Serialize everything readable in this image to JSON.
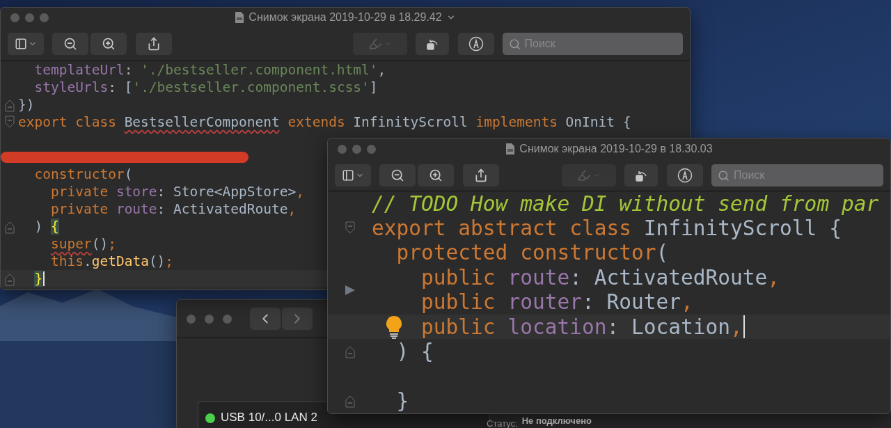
{
  "desktop": {
    "network_window": {
      "list_item": {
        "label": "USB 10/...0 LAN 2",
        "color": "#4cd04b"
      },
      "status_label": "Статус:",
      "status_value": "Не подключено"
    },
    "windows": [
      {
        "title": "Снимок экрана 2019-10-29 в 18.29.42",
        "title_menu": true,
        "toolbar": {
          "highlight_disabled": true,
          "search_placeholder": "Поиск"
        },
        "lines": [
          {
            "tokens": [
              {
                "text": "  templateUrl",
                "kind": "property"
              },
              {
                "text": ": ",
                "kind": "plain"
              },
              {
                "text": "'./bestseller.component.html'",
                "kind": "string"
              },
              {
                "text": ",",
                "kind": "plain"
              }
            ]
          },
          {
            "tokens": [
              {
                "text": "  styleUrls",
                "kind": "property"
              },
              {
                "text": ": [",
                "kind": "plain"
              },
              {
                "text": "'./bestseller.component.scss'",
                "kind": "string"
              },
              {
                "text": "]",
                "kind": "plain"
              }
            ]
          },
          {
            "fold_end": true,
            "tokens": [
              {
                "text": "})",
                "kind": "plain"
              }
            ]
          },
          {
            "fold_start": true,
            "tokens": [
              {
                "text": "export class ",
                "kind": "keyword"
              },
              {
                "text": "BestsellerComponent",
                "kind": "plain",
                "squiggle": true
              },
              {
                "text": " extends ",
                "kind": "keyword"
              },
              {
                "text": "InfinityScroll ",
                "kind": "plain"
              },
              {
                "text": "implements ",
                "kind": "keyword"
              },
              {
                "text": "OnInit {",
                "kind": "plain"
              }
            ]
          },
          {
            "blank": true
          },
          {
            "redacted": true
          },
          {
            "tokens": [
              {
                "text": "  constructor",
                "kind": "keyword"
              },
              {
                "text": "(",
                "kind": "plain"
              }
            ]
          },
          {
            "tokens": [
              {
                "text": "    private ",
                "kind": "keyword"
              },
              {
                "text": "store",
                "kind": "property"
              },
              {
                "text": ": Store<AppStore>",
                "kind": "plain"
              },
              {
                "text": ",",
                "kind": "keyword"
              }
            ]
          },
          {
            "tokens": [
              {
                "text": "    private ",
                "kind": "keyword"
              },
              {
                "text": "route",
                "kind": "property"
              },
              {
                "text": ": ActivatedRoute",
                "kind": "plain"
              },
              {
                "text": ",",
                "kind": "keyword"
              }
            ]
          },
          {
            "fold_end": true,
            "tokens": [
              {
                "text": "  ) ",
                "kind": "plain"
              },
              {
                "text": "{",
                "kind": "brace_match"
              }
            ]
          },
          {
            "tokens": [
              {
                "text": "    super",
                "kind": "keyword",
                "squiggle": true
              },
              {
                "text": "()",
                "kind": "plain"
              },
              {
                "text": ";",
                "kind": "keyword"
              }
            ]
          },
          {
            "tokens": [
              {
                "text": "    this",
                "kind": "keyword"
              },
              {
                "text": ".",
                "kind": "plain"
              },
              {
                "text": "getData",
                "kind": "function"
              },
              {
                "text": "()",
                "kind": "plain"
              },
              {
                "text": ";",
                "kind": "keyword"
              }
            ]
          },
          {
            "fold_end": true,
            "current": true,
            "cursor": true,
            "tokens": [
              {
                "text": "  }",
                "kind": "brace_match"
              }
            ]
          }
        ]
      },
      {
        "title": "Снимок экрана 2019-10-29 в 18.30.03",
        "title_menu": false,
        "toolbar": {
          "highlight_disabled": true,
          "search_placeholder": "Поиск"
        },
        "lines": [
          {
            "tokens": [
              {
                "text": "// TODO How make DI without send from par",
                "kind": "comment"
              }
            ]
          },
          {
            "fold_start": true,
            "tokens": [
              {
                "text": "export abstract class ",
                "kind": "keyword"
              },
              {
                "text": "InfinityScroll {",
                "kind": "plain"
              }
            ]
          },
          {
            "tokens": [
              {
                "text": "  protected constructor",
                "kind": "keyword"
              },
              {
                "text": "(",
                "kind": "plain"
              }
            ]
          },
          {
            "arrow": true,
            "tokens": [
              {
                "text": "    public ",
                "kind": "keyword"
              },
              {
                "text": "route",
                "kind": "property"
              },
              {
                "text": ": ActivatedRoute",
                "kind": "plain"
              },
              {
                "text": ",",
                "kind": "keyword"
              }
            ]
          },
          {
            "tokens": [
              {
                "text": "    public ",
                "kind": "keyword"
              },
              {
                "text": "router",
                "kind": "property"
              },
              {
                "text": ": Router",
                "kind": "plain"
              },
              {
                "text": ",",
                "kind": "keyword"
              }
            ]
          },
          {
            "current": true,
            "cursor": true,
            "bulb": true,
            "tokens": [
              {
                "text": "    public ",
                "kind": "keyword"
              },
              {
                "text": "location",
                "kind": "property"
              },
              {
                "text": ": Location",
                "kind": "plain"
              },
              {
                "text": ",",
                "kind": "keyword"
              }
            ]
          },
          {
            "fold_end": true,
            "tokens": [
              {
                "text": "  ) {",
                "kind": "plain"
              }
            ]
          },
          {
            "blank": true
          },
          {
            "fold_end": true,
            "tokens": [
              {
                "text": "  }",
                "kind": "plain"
              }
            ]
          }
        ]
      }
    ]
  }
}
